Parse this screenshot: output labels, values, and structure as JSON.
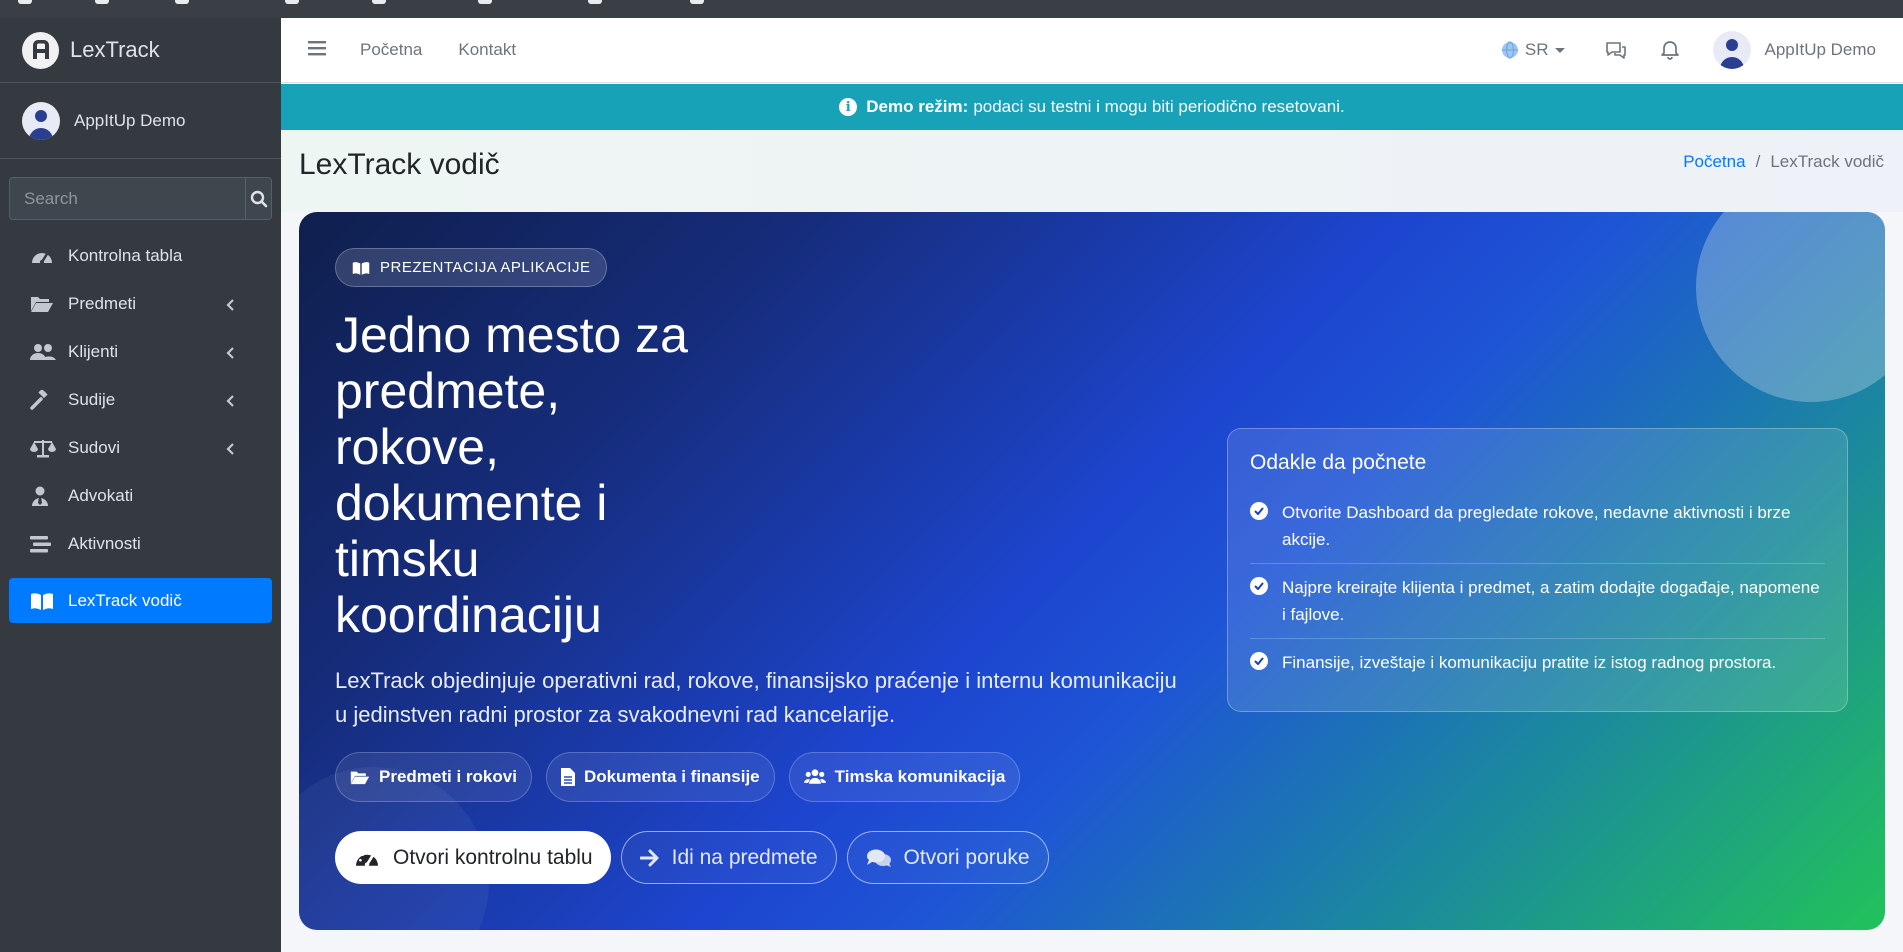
{
  "brand": {
    "name": "LexTrack"
  },
  "user": {
    "name": "AppItUp Demo"
  },
  "sidebar": {
    "search_placeholder": "Search",
    "items": [
      {
        "label": "Kontrolna tabla",
        "icon": "gauge-icon"
      },
      {
        "label": "Predmeti",
        "icon": "folder-open-icon",
        "has_children": true
      },
      {
        "label": "Klijenti",
        "icon": "users-icon",
        "has_children": true
      },
      {
        "label": "Sudije",
        "icon": "gavel-icon",
        "has_children": true
      },
      {
        "label": "Sudovi",
        "icon": "scale-icon",
        "has_children": true
      },
      {
        "label": "Advokati",
        "icon": "user-tie-icon"
      },
      {
        "label": "Aktivnosti",
        "icon": "stream-icon"
      },
      {
        "label": "LexTrack vodič",
        "icon": "book-open-icon",
        "active": true
      }
    ]
  },
  "header": {
    "links": [
      "Početna",
      "Kontakt"
    ],
    "language": "SR",
    "user_name": "AppItUp Demo"
  },
  "banner": {
    "strong": "Demo režim:",
    "text": "podaci su testni i mogu biti periodično resetovani.",
    "color": "#17a2b8"
  },
  "page": {
    "title": "LexTrack vodič",
    "breadcrumb": {
      "home": "Početna",
      "current": "LexTrack vodič"
    }
  },
  "hero": {
    "pill": "PREZENTACIJA APLIKACIJE",
    "title": "Jedno mesto za predmete, rokove, dokumente i timsku koordinaciju",
    "description": "LexTrack objedinjuje operativni rad, rokove, finansijsko praćenje i internu komunikaciju u jedinstven radni prostor za svakodnevni rad kancelarije.",
    "features": [
      {
        "label": "Predmeti i rokovi",
        "icon": "folder-open-icon"
      },
      {
        "label": "Dokumenta i finansije",
        "icon": "file-icon"
      },
      {
        "label": "Timska komunikacija",
        "icon": "users-icon"
      }
    ],
    "actions": [
      {
        "label": "Otvori kontrolnu tablu",
        "icon": "gauge-icon"
      },
      {
        "label": "Idi na predmete",
        "icon": "arrow-right-icon"
      },
      {
        "label": "Otvori poruke",
        "icon": "comments-icon"
      }
    ]
  },
  "start_card": {
    "title": "Odakle da počnete",
    "items": [
      "Otvorite Dashboard da pregledate rokove, nedavne aktivnosti i brze akcije.",
      "Najpre kreirajte klijenta i predmet, a zatim dodajte događaje, napomene i fajlove.",
      "Finansije, izveštaje i komunikaciju pratite iz istog radnog prostora."
    ]
  },
  "colors": {
    "sidebar": "#343a40",
    "active": "#007bff",
    "banner": "#17a2b8"
  }
}
